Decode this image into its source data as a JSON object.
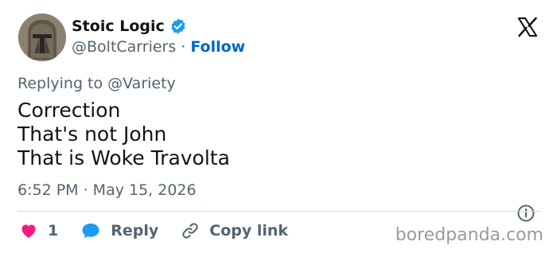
{
  "author": {
    "name": "Stoic Logic",
    "handle": "@BoltCarriers",
    "separator": "·",
    "follow_label": "Follow",
    "avatar_icon": "spartan-helmet-avatar",
    "verified_color": "#1d9bf0"
  },
  "platform_icon": "x-logo-icon",
  "reply_context": "Replying to @Variety",
  "tweet": {
    "lines": [
      "Correction",
      "That's not John",
      "That is Woke Travolta"
    ]
  },
  "timestamp": "6:52 PM · May 15, 2026",
  "actions": {
    "like_count": "1",
    "like_color": "#f91880",
    "reply_label": "Reply",
    "reply_color": "#1d9bf0",
    "copy_link_label": "Copy link"
  },
  "watermark": "boredpanda.com"
}
